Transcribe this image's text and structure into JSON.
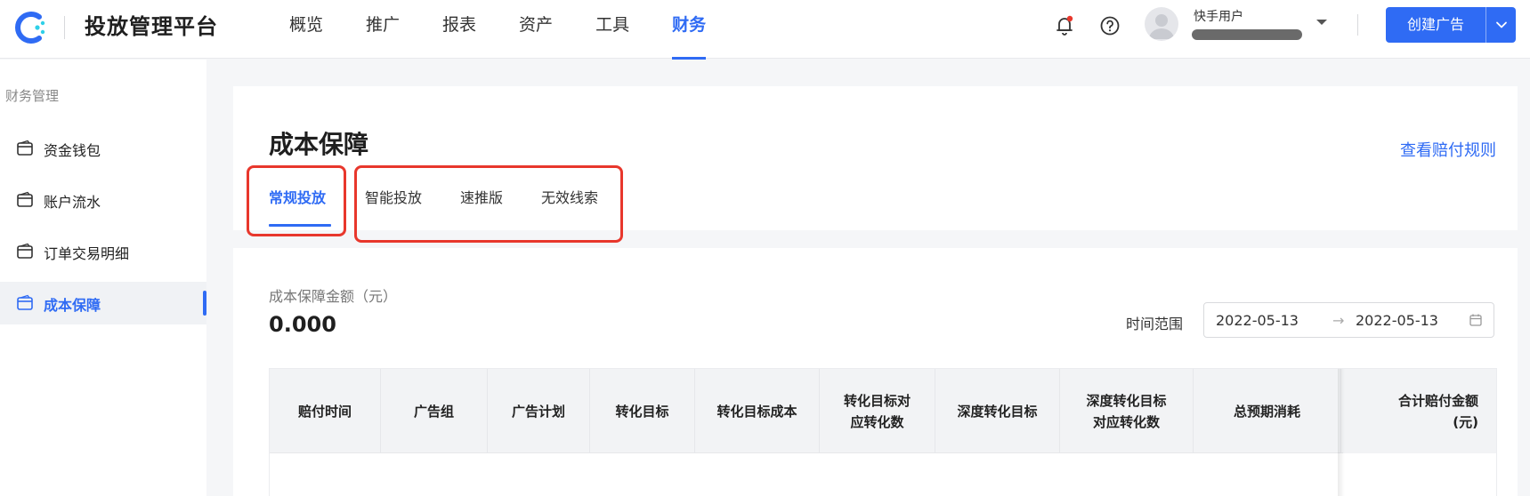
{
  "app": {
    "brand": "投放管理平台",
    "logo_icon": "kuaishou-logo-icon"
  },
  "nav": {
    "items": [
      {
        "label": "概览",
        "active": false
      },
      {
        "label": "推广",
        "active": false
      },
      {
        "label": "报表",
        "active": false
      },
      {
        "label": "资产",
        "active": false
      },
      {
        "label": "工具",
        "active": false
      },
      {
        "label": "财务",
        "active": true
      }
    ]
  },
  "header_right": {
    "notification_icon": "bell-icon",
    "help_icon": "question-icon",
    "user_name": "快手用户",
    "create_button": "创建广告"
  },
  "sidebar": {
    "title": "财务管理",
    "items": [
      {
        "label": "资金钱包",
        "icon": "wallet-icon",
        "active": false
      },
      {
        "label": "账户流水",
        "icon": "wallet-icon",
        "active": false
      },
      {
        "label": "订单交易明细",
        "icon": "wallet-icon",
        "active": false
      },
      {
        "label": "成本保障",
        "icon": "wallet-icon",
        "active": true
      }
    ]
  },
  "page": {
    "title": "成本保障",
    "rules_link": "查看赔付规则",
    "tabs": [
      {
        "label": "常规投放",
        "active": true
      },
      {
        "label": "智能投放",
        "active": false
      },
      {
        "label": "速推版",
        "active": false
      },
      {
        "label": "无效线索",
        "active": false
      }
    ]
  },
  "summary": {
    "amount_label": "成本保障金额（元）",
    "amount_value": "0.000",
    "range_label": "时间范围",
    "range_start": "2022-05-13",
    "range_sep": "→",
    "range_end": "2022-05-13"
  },
  "table": {
    "columns": [
      {
        "line1": "赔付时间",
        "line2": ""
      },
      {
        "line1": "广告组",
        "line2": ""
      },
      {
        "line1": "广告计划",
        "line2": ""
      },
      {
        "line1": "转化目标",
        "line2": ""
      },
      {
        "line1": "转化目标成本",
        "line2": ""
      },
      {
        "line1": "转化目标对",
        "line2": "应转化数"
      },
      {
        "line1": "深度转化目标",
        "line2": ""
      },
      {
        "line1": "深度转化目标",
        "line2": "对应转化数"
      },
      {
        "line1": "总预期消耗",
        "line2": ""
      },
      {
        "line1": "合计赔付金额",
        "line2": "(元)"
      }
    ]
  },
  "colors": {
    "accent": "#2f6bf4",
    "highlight_box": "#e8372c"
  }
}
